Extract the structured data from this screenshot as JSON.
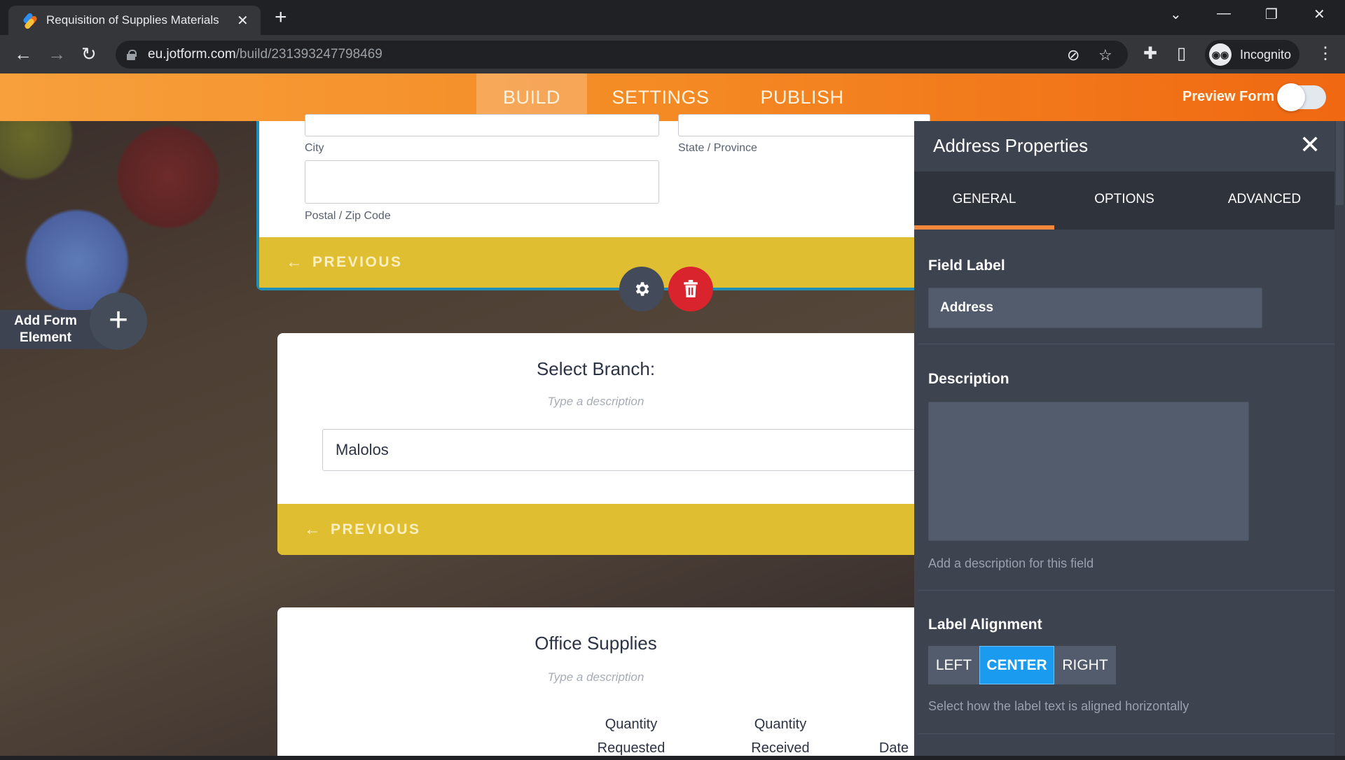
{
  "browser": {
    "tab_title": "Requisition of Supplies Materials",
    "url_host": "eu.jotform.com",
    "url_path": "/build/231393247798469",
    "profile_label": "Incognito",
    "icons": {
      "back": "←",
      "forward": "→",
      "reload": "↻",
      "new_tab": "+",
      "tab_close": "✕",
      "eye_off": "⊘",
      "star": "☆",
      "puzzle": "✚",
      "sidebar": "▯",
      "menu": "⋮",
      "tab_search": "⌄",
      "minimize": "—",
      "restore": "❐",
      "close": "✕",
      "incognito": "◉◉"
    }
  },
  "builder_nav": {
    "tabs": [
      {
        "label": "BUILD",
        "active": true
      },
      {
        "label": "SETTINGS",
        "active": false
      },
      {
        "label": "PUBLISH",
        "active": false
      }
    ],
    "preview_label": "Preview Form",
    "preview_enabled": false
  },
  "canvas": {
    "add_element_label": "Add Form Element",
    "add_icon": "+",
    "address_card": {
      "subfields": [
        "City",
        "State / Province",
        "Postal / Zip Code"
      ],
      "previous_label": "PREVIOUS",
      "arrow": "←"
    },
    "field_actions": {
      "gear_icon": "⚙",
      "trash_icon": "🗑"
    },
    "branch_card": {
      "title": "Select Branch:",
      "description_placeholder": "Type a description",
      "selected_value": "Malolos",
      "previous_label": "PREVIOUS",
      "arrow": "←"
    },
    "supplies_card": {
      "title": "Office Supplies",
      "description_placeholder": "Type a description",
      "columns": [
        "Quantity Requested",
        "Quantity Received",
        "Date"
      ]
    }
  },
  "properties_panel": {
    "title": "Address Properties",
    "close_icon": "✕",
    "tabs": [
      {
        "label": "GENERAL",
        "active": true
      },
      {
        "label": "OPTIONS",
        "active": false
      },
      {
        "label": "ADVANCED",
        "active": false
      }
    ],
    "field_label": {
      "label": "Field Label",
      "value": "Address"
    },
    "description": {
      "label": "Description",
      "value": "",
      "hint": "Add a description for this field"
    },
    "label_alignment": {
      "label": "Label Alignment",
      "options": [
        "LEFT",
        "CENTER",
        "RIGHT"
      ],
      "selected": "CENTER",
      "hint": "Select how the label text is aligned horizontally"
    }
  },
  "colors": {
    "brand_orange": "#f48a24",
    "previous_bar": "#e0be32",
    "selected_border": "#1f8fb8",
    "delete_red": "#d9232d",
    "gear_dark": "#434a59",
    "panel_bg": "#3e4350",
    "active_segment": "#1a9bf0",
    "tab_indicator": "#f5883b"
  }
}
